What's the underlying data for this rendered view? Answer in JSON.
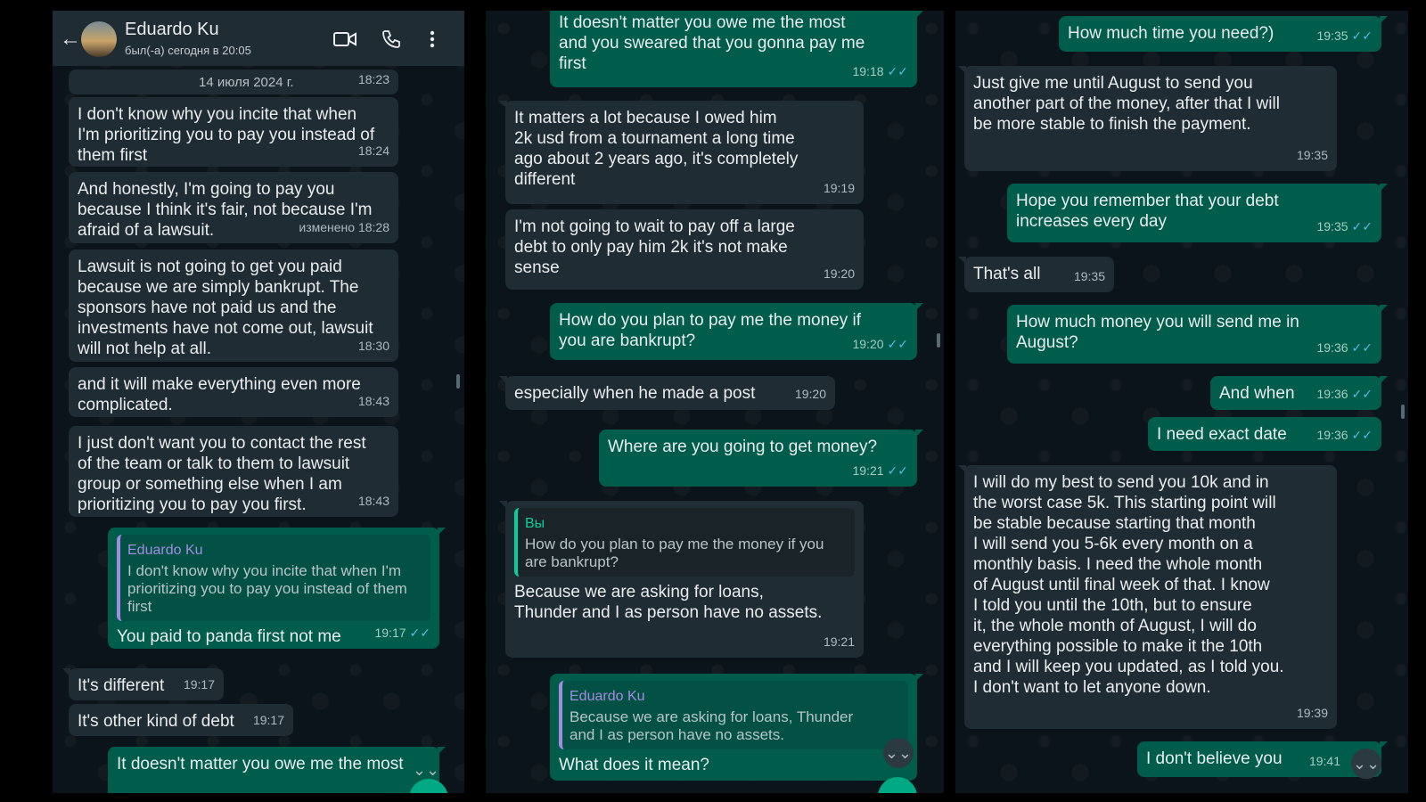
{
  "header": {
    "contact_name": "Eduardo Ku",
    "last_seen": "был(-а) сегодня в 20:05",
    "back_icon": "arrow-left-icon",
    "video_icon": "video-camera-icon",
    "call_icon": "phone-icon",
    "menu_icon": "more-vertical-icon"
  },
  "colors": {
    "incoming_bubble": "#202c33",
    "outgoing_bubble": "#005c4b",
    "read_ticks": "#53bdeb",
    "background": "#0b141a"
  },
  "panel1": {
    "date_chip": "14 июля 2024 г.",
    "date_chip_time": "18:23",
    "messages": [
      {
        "text": "I don't know why you incite that when\nI'm prioritizing you to pay you instead of\nthem first",
        "time": "18:24"
      },
      {
        "text": "And honestly, I'm going to pay you\nbecause I think it's fair, not because I'm\nafraid of a lawsuit.",
        "time": "изменено 18:28"
      },
      {
        "text": "Lawsuit  is not going to get you paid\nbecause we are simply bankrupt. The\nsponsors have not paid us and the\ninvestments have not come out, lawsuit\nwill not help at all.",
        "time": "18:30"
      },
      {
        "text": "and it will make everything even more\ncomplicated.",
        "time": "18:43"
      },
      {
        "text": "I just don't want you to contact the rest\nof the team  or talk to them to lawsuit\ngroup or something else when I am\nprioritizing you to pay you first.",
        "time": "18:43"
      },
      {
        "quote_author": "Eduardo Ku",
        "quote_text": "I don't know why you incite that when I'm\nprioritizing you to pay you instead of them\nfirst",
        "text": "You paid to panda first not me",
        "time": "19:17"
      },
      {
        "text": "It's different",
        "time": "19:17"
      },
      {
        "text": "It's other kind of debt",
        "time": "19:17"
      },
      {
        "text": "It doesn't matter you owe me the most",
        "time": ""
      }
    ]
  },
  "panel2": {
    "messages": [
      {
        "text": "It doesn't matter you owe me the most\nand you sweared that you gonna pay me\nfirst",
        "time": "19:18"
      },
      {
        "text": "It matters a lot because I owed him\n2k usd from a tournament a long time\nago  about 2 years ago, it's completely\ndifferent",
        "time": "19:19"
      },
      {
        "text": "I'm not going to wait to pay off a large\ndebt to only pay him 2k it's not make\nsense",
        "time": "19:20"
      },
      {
        "text": "How do you plan to pay me the money if\nyou are bankrupt?",
        "time": "19:20"
      },
      {
        "text": "especially when he made a post",
        "time": "19:20"
      },
      {
        "text": "Where are you going to get money?",
        "time": "19:21"
      },
      {
        "quote_author": "Вы",
        "quote_text": "How do you plan to pay me the money if you\nare bankrupt?",
        "text": "Because we are asking for loans,\nThunder and I as person have no assets.",
        "time": "19:21"
      },
      {
        "quote_author": "Eduardo Ku",
        "quote_text": "Because we are asking for loans, Thunder\nand I as person have no assets.",
        "text": "What does it mean?",
        "time": ""
      }
    ]
  },
  "panel3": {
    "messages": [
      {
        "text": "How much time you need?)",
        "time": "19:35"
      },
      {
        "text": "Just give me until August to send you\nanother part of the money, after that I will\nbe more stable to finish the payment.",
        "time": "19:35"
      },
      {
        "text": "Hope you remember that your debt\nincreases every day",
        "time": "19:35"
      },
      {
        "text": "That's all",
        "time": "19:35"
      },
      {
        "text": "How much money you will send me in\nAugust?",
        "time": "19:36"
      },
      {
        "text": "And when",
        "time": "19:36"
      },
      {
        "text": "I need exact date",
        "time": "19:36"
      },
      {
        "text": "I will do my best to send you 10k and in\nthe worst case 5k. This starting point will\nbe stable because starting that month\nI will send you 5-6k every month on a\nmonthly basis. I need the whole month\nof August until final week of that. I know\nI told you until the 10th, but to ensure\nit, the whole month of August, I will do\neverything possible to make it the 10th\nand I will keep you updated, as I told you.\nI don't want to let anyone down.",
        "time": "19:39"
      },
      {
        "text": "I don't believe you",
        "time": "19:41"
      }
    ]
  },
  "icons": {
    "read_ticks": "✓✓",
    "scroll_down": "⌄⌄"
  }
}
